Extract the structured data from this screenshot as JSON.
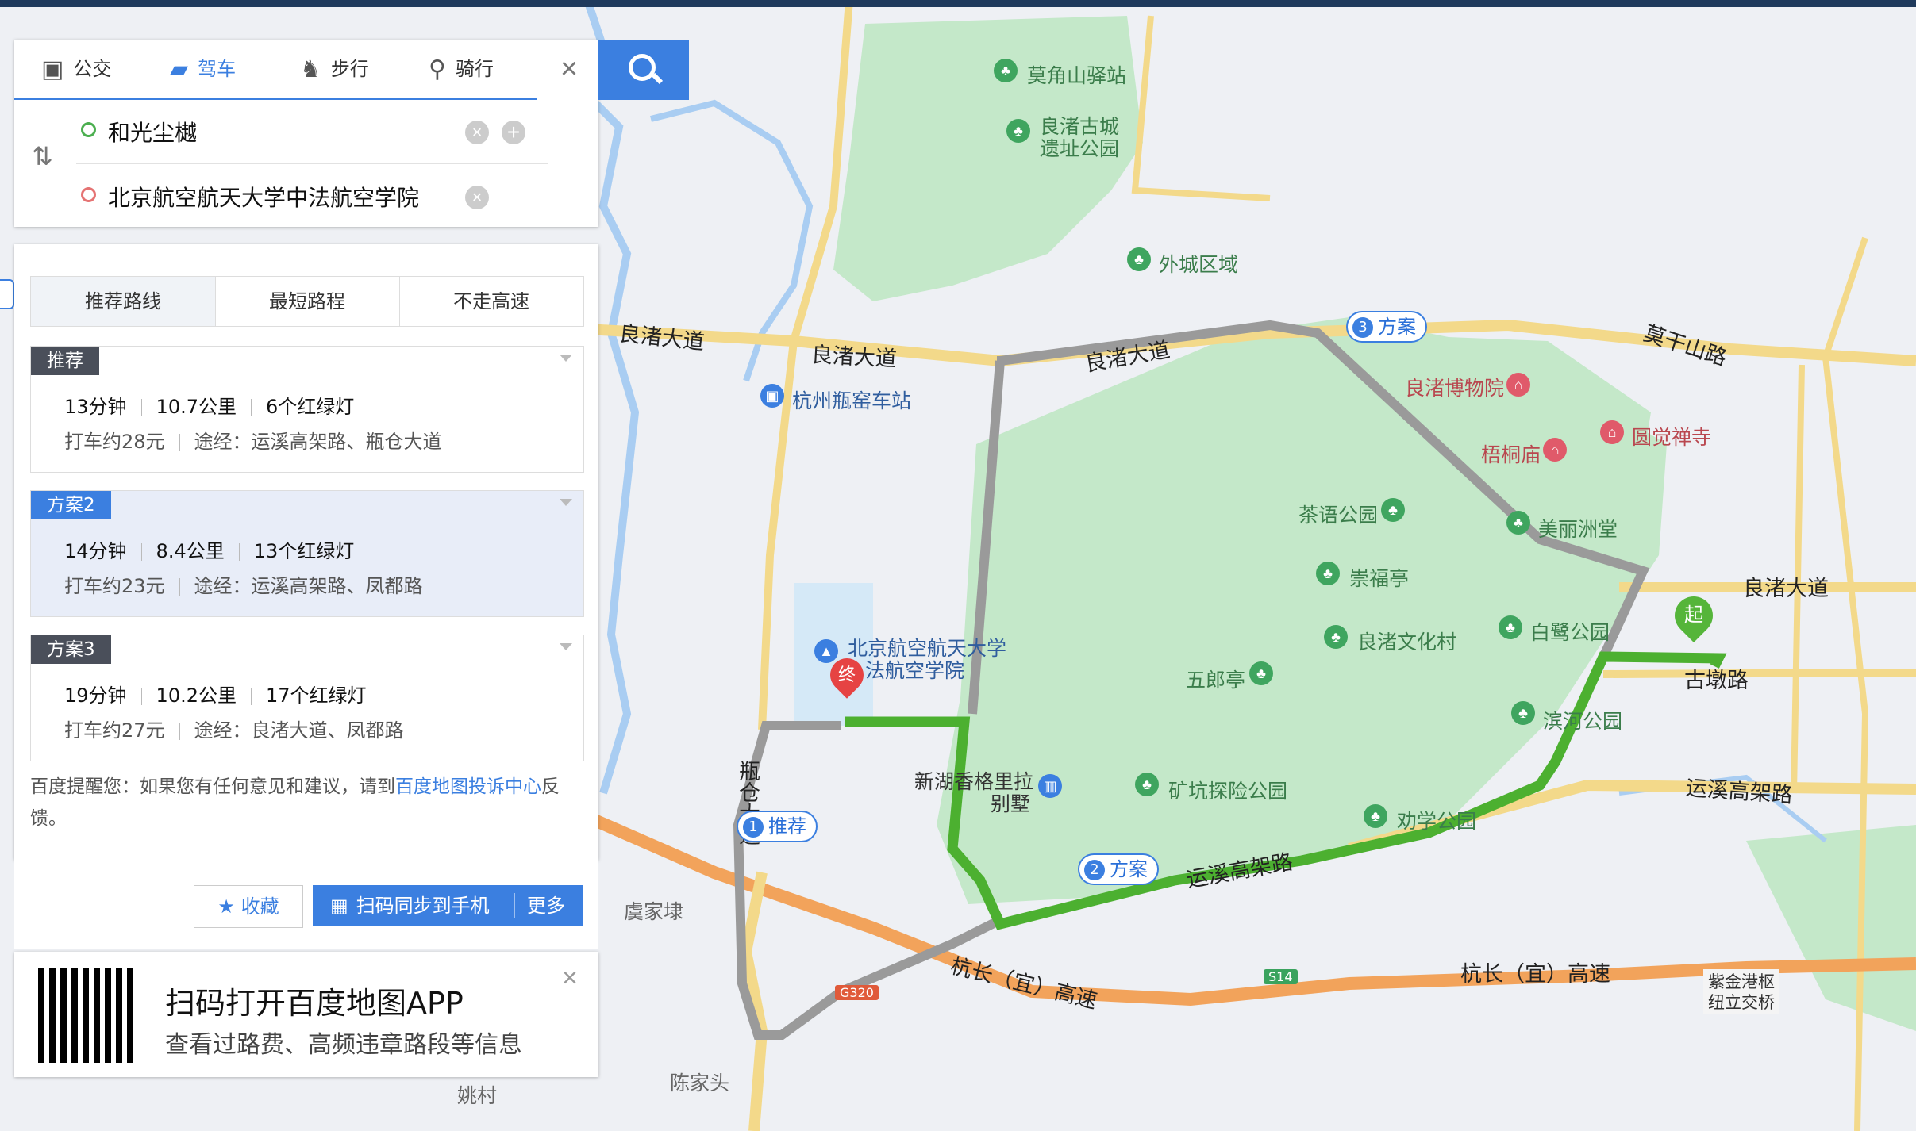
{
  "transport_modes": [
    {
      "label": "公交",
      "icon": "bus-icon"
    },
    {
      "label": "驾车",
      "icon": "car-icon",
      "active": true
    },
    {
      "label": "步行",
      "icon": "walk-icon"
    },
    {
      "label": "骑行",
      "icon": "bike-icon"
    }
  ],
  "search": {
    "origin": "和光尘樾",
    "destination": "北京航空航天大学中法航空学院"
  },
  "route_tabs": [
    "推荐路线",
    "最短路程",
    "不走高速"
  ],
  "routes": [
    {
      "badge": "推荐",
      "time": "13分钟",
      "distance": "10.7公里",
      "lights": "6个红绿灯",
      "taxi": "打车约28元",
      "via": "途经：运溪高架路、瓶仓大道"
    },
    {
      "badge": "方案2",
      "time": "14分钟",
      "distance": "8.4公里",
      "lights": "13个红绿灯",
      "taxi": "打车约23元",
      "via": "途经：运溪高架路、凤都路"
    },
    {
      "badge": "方案3",
      "time": "19分钟",
      "distance": "10.2公里",
      "lights": "17个红绿灯",
      "taxi": "打车约27元",
      "via": "途经：良渚大道、凤都路"
    }
  ],
  "notice": {
    "prefix": "百度提醒您：如果您有任何意见和建议，请到",
    "link": "百度地图投诉中心",
    "suffix": "反馈。"
  },
  "actions": {
    "favorite": "收藏",
    "scan_sync": "扫码同步到手机",
    "more": "更多"
  },
  "qr_promo": {
    "title": "扫码打开百度地图APP",
    "subtitle": "查看过路费、高频违章路段等信息"
  },
  "map_labels": {
    "moja": "莫角山驿站",
    "liangzhu_city": "良渚古城",
    "liangzhu_city2": "遗址公园",
    "outer_city": "外城区域",
    "road_lz_left": "良渚大道",
    "road_lz_mid": "良渚大道",
    "road_lz_right": "良渚大道",
    "road_lz_east": "良渚大道",
    "moganshan": "莫干山路",
    "museum": "良渚博物院",
    "temple": "圆觉禅寺",
    "wutong": "梧桐庙",
    "station": "杭州瓶窑车站",
    "chayu": "茶语公园",
    "meili": "美丽洲堂",
    "chongfu": "崇福亭",
    "culture": "良渚文化村",
    "bailu": "白鹭公园",
    "wulang": "五郎亭",
    "binhe": "滨河公园",
    "gudun": "古墩路",
    "xinhu": "新湖香格里拉",
    "xinhu2": "别墅",
    "kuangkeng": "矿坑探险公园",
    "quxue": "劝学公园",
    "yunxi_east": "运溪高架路",
    "yunxi_mid": "运溪高架路",
    "pingcang": "瓶仓大道",
    "hangchang_left": "杭长（宜）高速",
    "hangchang_right": "杭长（宜）高速",
    "yujia": "虞家埭",
    "chenjia": "陈家头",
    "yaocun": "姚村",
    "zijingang": "紫金港枢",
    "zijingang2": "纽立交桥",
    "school": "北京航空航天大学",
    "school2": "法航空学院",
    "g320": "G320",
    "s14": "S14"
  },
  "route_tags": [
    {
      "num": "1",
      "label": "推荐"
    },
    {
      "num": "2",
      "label": "方案"
    },
    {
      "num": "3",
      "label": "方案"
    }
  ],
  "markers": {
    "start": "起",
    "end": "终"
  },
  "colors": {
    "accent": "#3b7fe0",
    "route_main": "#4cb030",
    "route_alt": "#9a9a9a",
    "park": "#c7ebcc"
  }
}
